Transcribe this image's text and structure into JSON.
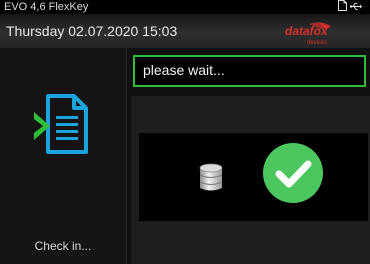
{
  "topbar": {
    "device_name": "EVO 4,6 FlexKey",
    "icons": [
      "document-icon",
      "usb-icon"
    ]
  },
  "header": {
    "datetime": "Thursday 02.07.2020 15:03",
    "logo": {
      "text": "datafox",
      "subtext": "devices",
      "color": "#d6302b"
    }
  },
  "left_panel": {
    "icon": "document-arrow-icon",
    "label": "Check in..."
  },
  "message": {
    "text": "please wait...",
    "border_color": "#2fbd3a"
  },
  "status": {
    "icons": [
      "database-icon",
      "check-icon"
    ],
    "success_color": "#4cc65e"
  }
}
